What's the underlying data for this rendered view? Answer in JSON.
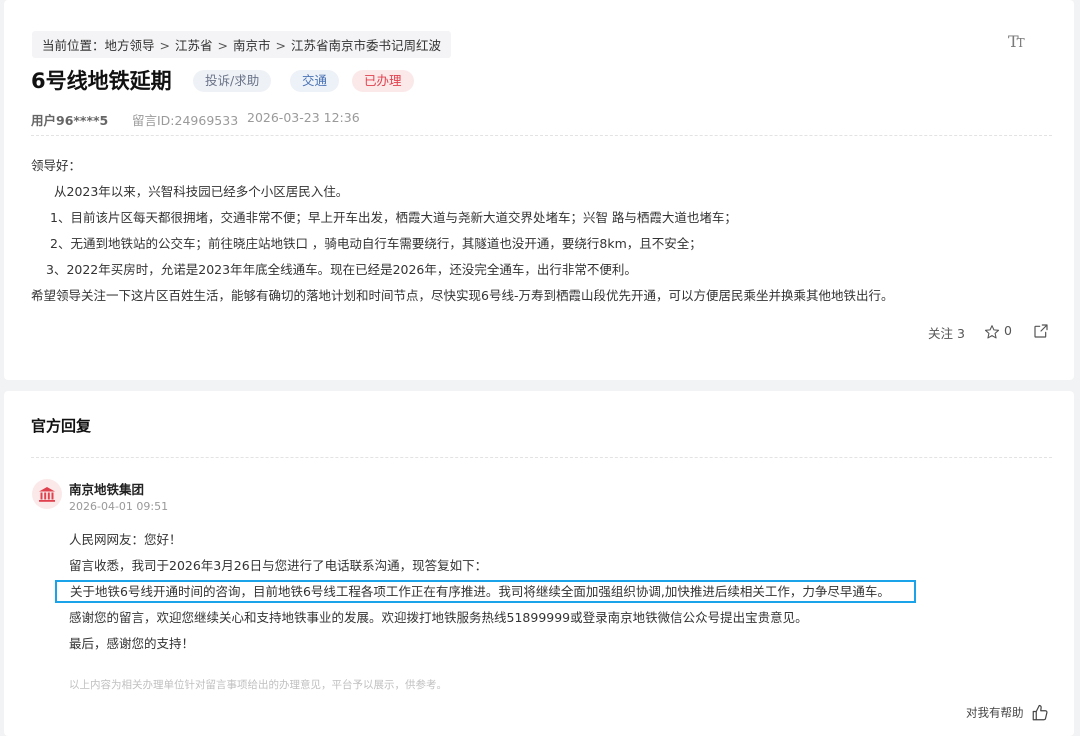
{
  "breadcrumb": {
    "prefix": "当前位置：",
    "items": [
      "地方领导",
      "江苏省",
      "南京市",
      "江苏省南京市委书记周红波"
    ],
    "separator": ">"
  },
  "font_toggle": {
    "icon": "font-size-icon",
    "label_big": "T",
    "label_small": "T"
  },
  "message": {
    "title": "6号线地铁延期",
    "tags": {
      "category": "投诉/求助",
      "field": "交通",
      "status": "已办理"
    },
    "user": "用户96****5",
    "id": "留言ID:24969533",
    "time": "2026-03-23 12:36",
    "body": [
      "领导好：",
      "从2023年以来，兴智科技园已经多个小区居民入住。",
      "1、目前该片区每天都很拥堵，交通非常不便；早上开车出发，栖霞大道与尧新大道交界处堵车；兴智   路与栖霞大道也堵车；",
      "2、无通到地铁站的公交车；前往晓庄站地铁口 ，骑电动自行车需要绕行，其隧道也没开通，要绕行8km，且不安全；",
      "3、2022年买房时，允诺是2023年年底全线通车。现在已经是2026年，还没完全通车，出行非常不便利。",
      "希望领导关注一下这片区百姓生活，能够有确切的落地计划和时间节点，尽快实现6号线-万寿到栖霞山段优先开通，可以方便居民乘坐并换乘其他地铁出行。"
    ],
    "actions": {
      "follow_label": "关注",
      "follow_count": "3",
      "star_count": "0"
    }
  },
  "reply": {
    "section_title": "官方回复",
    "org_name": "南京地铁集团",
    "org_time": "2026-04-01 09:51",
    "lines": [
      "人民网网友：您好！",
      "留言收悉，我司于2026年3月26日与您进行了电话联系沟通，现答复如下：",
      "关于地铁6号线开通时间的咨询，目前地铁6号线工程各项工作正在有序推进。我司将继续全面加强组织协调,加快推进后续相关工作，力争尽早通车。",
      "感谢您的留言，欢迎您继续关心和支持地铁事业的发展。欢迎拨打地铁服务热线51899999或登录南京地铁微信公众号提出宝贵意见。",
      "最后，感谢您的支持！"
    ],
    "disclaimer": "以上内容为相关办理单位针对留言事项给出的办理意见，平台予以展示，供参考。",
    "helpful_label": "对我有帮助"
  },
  "colors": {
    "highlight_border": "#1aa3e8",
    "status_tag": "#e0414e",
    "field_tag": "#4a73b5"
  }
}
